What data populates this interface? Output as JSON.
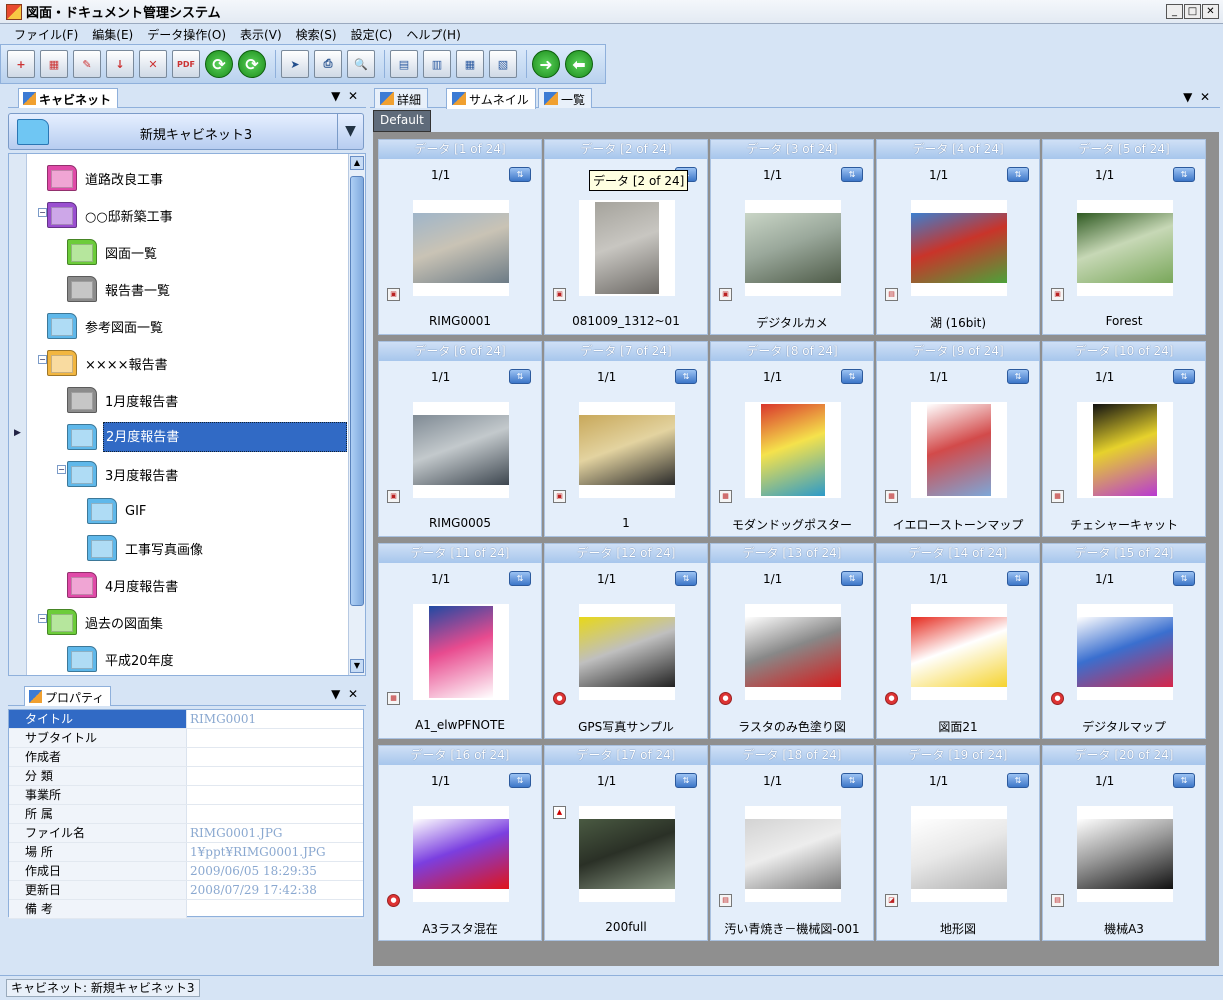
{
  "window": {
    "title": "図面・ドキュメント管理システム"
  },
  "menu": [
    "ファイル(F)",
    "編集(E)",
    "データ操作(O)",
    "表示(V)",
    "検索(S)",
    "設定(C)",
    "ヘルプ(H)"
  ],
  "toolbar": {
    "buttons": [
      "new-data",
      "new-folder",
      "edit",
      "import",
      "delete",
      "pdf",
      "save-green",
      "save-green-2",
      "send",
      "print",
      "preview",
      "view-detail",
      "view-list",
      "view-thumb",
      "view-split",
      "forward",
      "back"
    ]
  },
  "cabinet_panel": {
    "tab": "キャビネット",
    "pin": "▼",
    "close": "✕",
    "selected_cabinet": "新規キャビネット3",
    "dropdown": "▼"
  },
  "tree": [
    {
      "label": "道路改良工事",
      "color": "#e04aa8"
    },
    {
      "label": "○○邸新築工事",
      "color": "#9a4fd0"
    },
    {
      "label": "図面一覧",
      "color": "#6ccc3a"
    },
    {
      "label": "報告書一覧",
      "color": "#8c8c8c"
    },
    {
      "label": "参考図面一覧",
      "color": "#5fb8ea"
    },
    {
      "label": "××××報告書",
      "color": "#f2b640"
    },
    {
      "label": "1月度報告書",
      "color": "#8c8c8c"
    },
    {
      "label": "2月度報告書",
      "color": "#5fb8ea"
    },
    {
      "label": "3月度報告書",
      "color": "#5fb8ea"
    },
    {
      "label": "GIF",
      "color": "#5fb8ea"
    },
    {
      "label": "工事写真画像",
      "color": "#5fb8ea"
    },
    {
      "label": "4月度報告書",
      "color": "#e04aa8"
    },
    {
      "label": "過去の図面集",
      "color": "#6ccc3a"
    },
    {
      "label": "平成20年度",
      "color": "#5fb8ea"
    }
  ],
  "properties_panel": {
    "tab": "プロパティ",
    "pin": "▼",
    "close": "✕"
  },
  "properties": [
    {
      "key": "タイトル",
      "value": "RIMG0001"
    },
    {
      "key": "サブタイトル",
      "value": ""
    },
    {
      "key": "作成者",
      "value": ""
    },
    {
      "key": "分 類",
      "value": ""
    },
    {
      "key": "事業所",
      "value": ""
    },
    {
      "key": "所 属",
      "value": ""
    },
    {
      "key": "ファイル名",
      "value": "RIMG0001.JPG"
    },
    {
      "key": "場 所",
      "value": "1¥ppt¥RIMG0001.JPG"
    },
    {
      "key": "作成日",
      "value": "2009/06/05 18:29:35"
    },
    {
      "key": "更新日",
      "value": "2008/07/29 17:42:38"
    },
    {
      "key": "備 考",
      "value": ""
    }
  ],
  "view_tabs": [
    "詳細",
    "サムネイル",
    "一覧"
  ],
  "view_panel_controls": {
    "pin": "▼",
    "close": "✕"
  },
  "group_tab": "Default",
  "tooltip": "データ [2 of 24]",
  "thumbnails": [
    {
      "header": "データ [1 of 24]",
      "page": "1/1",
      "name": "RIMG0001",
      "ftype": "jpg",
      "colors": [
        "#9fb5c9",
        "#6c7b86",
        "#c9c3b5"
      ]
    },
    {
      "header": "データ [2 of 24]",
      "page": "1/1",
      "name": "081009_1312~01",
      "ftype": "jpg",
      "colors": [
        "#a5a39c",
        "#6d6a66",
        "#c8c6c1"
      ],
      "tall": true
    },
    {
      "header": "データ [3 of 24]",
      "page": "1/1",
      "name": "デジタルカメ",
      "ftype": "jpg",
      "colors": [
        "#c9d5c6",
        "#4f5c49",
        "#9aa89b"
      ]
    },
    {
      "header": "データ [4 of 24]",
      "page": "1/1",
      "name": "湖 (16bit)",
      "ftype": "png",
      "colors": [
        "#3c7fd0",
        "#4da23a",
        "#c9342a"
      ]
    },
    {
      "header": "データ [5 of 24]",
      "page": "1/1",
      "name": "Forest",
      "ftype": "jpg",
      "colors": [
        "#2f5a22",
        "#79a75a",
        "#c7d8b6"
      ]
    },
    {
      "header": "データ [6 of 24]",
      "page": "1/1",
      "name": "RIMG0005",
      "ftype": "jpg",
      "colors": [
        "#7f8a94",
        "#3d464f",
        "#c3c9cc"
      ]
    },
    {
      "header": "データ [7 of 24]",
      "page": "1/1",
      "name": "1",
      "ftype": "jpg",
      "colors": [
        "#c8a85a",
        "#2a2a2a",
        "#e3d3a0"
      ]
    },
    {
      "header": "データ [8 of 24]",
      "page": "1/1",
      "name": "モダンドッグポスター",
      "ftype": "gif",
      "colors": [
        "#d9362c",
        "#2c9ac9",
        "#f5e24c"
      ],
      "tall": true
    },
    {
      "header": "データ [9 of 24]",
      "page": "1/1",
      "name": "イエローストーンマップ",
      "ftype": "gif",
      "colors": [
        "#ffffff",
        "#7da7d8",
        "#d24a4a"
      ],
      "tall": true
    },
    {
      "header": "データ [10 of 24]",
      "page": "1/1",
      "name": "チェシャーキャット",
      "ftype": "gif",
      "colors": [
        "#111111",
        "#b83ad2",
        "#e6d22c"
      ],
      "tall": true
    },
    {
      "header": "データ [11 of 24]",
      "page": "1/1",
      "name": "A1_elwPFNOTE",
      "ftype": "gif",
      "colors": [
        "#1f4aa3",
        "#ffffff",
        "#e84b8f"
      ],
      "tall": true
    },
    {
      "header": "データ [12 of 24]",
      "page": "1/1",
      "name": "GPS写真サンプル",
      "ftype": "tif",
      "colors": [
        "#e8d818",
        "#222222",
        "#bfbfbf"
      ]
    },
    {
      "header": "データ [13 of 24]",
      "page": "1/1",
      "name": "ラスタのみ色塗り図",
      "ftype": "tif",
      "colors": [
        "#ffffff",
        "#d61b1b",
        "#888888"
      ]
    },
    {
      "header": "データ [14 of 24]",
      "page": "1/1",
      "name": "図面21",
      "ftype": "tif",
      "colors": [
        "#e52a1e",
        "#f5d32f",
        "#ffffff"
      ]
    },
    {
      "header": "データ [15 of 24]",
      "page": "1/1",
      "name": "デジタルマップ",
      "ftype": "tif",
      "colors": [
        "#ffffff",
        "#d7264a",
        "#3a6fcf"
      ]
    },
    {
      "header": "データ [16 of 24]",
      "page": "1/1",
      "name": "A3ラスタ混在",
      "ftype": "tif",
      "colors": [
        "#ffffff",
        "#e0141a",
        "#7b3fe0"
      ]
    },
    {
      "header": "データ [17 of 24]",
      "page": "1/1",
      "name": "200full",
      "ftype": "pdf",
      "colors": [
        "#4a5a42",
        "#8c9a86",
        "#2a3026"
      ]
    },
    {
      "header": "データ [18 of 24]",
      "page": "1/1",
      "name": "汚い青焼き－機械図-001",
      "ftype": "png",
      "colors": [
        "#d3d3d3",
        "#7a7a7a",
        "#ededed"
      ]
    },
    {
      "header": "データ [19 of 24]",
      "page": "1/1",
      "name": "地形図",
      "ftype": "dwg",
      "colors": [
        "#ffffff",
        "#b0b0b0",
        "#e8e8e8"
      ]
    },
    {
      "header": "データ [20 of 24]",
      "page": "1/1",
      "name": "機械A3",
      "ftype": "png",
      "colors": [
        "#ffffff",
        "#111111",
        "#9a9a9a"
      ]
    }
  ],
  "statusbar": {
    "text": "キャビネット: 新規キャビネット3"
  }
}
